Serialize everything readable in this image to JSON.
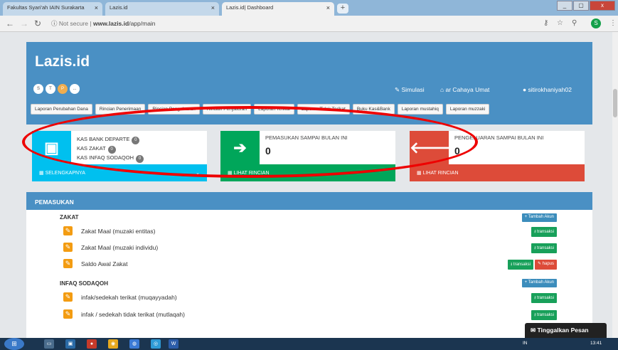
{
  "browser": {
    "tabs": [
      {
        "title": "Fakultas Syari'ah IAIN Surakarta",
        "state": "inactive"
      },
      {
        "title": "Lazis.id",
        "state": "inactive"
      },
      {
        "title": "Lazis.id| Dashboard",
        "state": "active"
      }
    ],
    "close_symbol": "×",
    "new_tab_symbol": "+",
    "url_prefix": "Not secure",
    "url_separator": "|",
    "url_host": "www.lazis.id",
    "url_path": "/app/main",
    "profile_initial": "S",
    "window_buttons": [
      "_",
      "▢",
      "x"
    ]
  },
  "app": {
    "logo": "Lazis.id",
    "avatars": [
      "S",
      "T",
      "P",
      "..."
    ],
    "top_nav": {
      "simulasi": "Simulasi",
      "org": "ar Cahaya Umat",
      "user": "sitirokhaniyah02"
    },
    "reports": [
      "Laporan Perubahan Dana",
      "Rincian Penerimaan",
      "Rincian Pengeluaran",
      "Rincian Penyaluran",
      "Laporan Terikat",
      "Laporan Tidak Terikat",
      "Buku Kas&Bank",
      "Laporan mustahiq",
      "Laporan muzzaki"
    ],
    "cards": {
      "kas": {
        "lines": [
          "KAS BANK DEPARTE",
          "KAS ZAKAT",
          "KAS INFAQ SODAQOH"
        ],
        "badges": [
          "0",
          "0",
          "0"
        ],
        "footer": "SELENGKAPNYA",
        "color": "#00c0ef"
      },
      "pemasukan": {
        "title": "PEMASUKAN SAMPAI BULAN INI",
        "value": "0",
        "footer": "LIHAT RINCIAN",
        "color": "#00a65a"
      },
      "pengeluaran": {
        "title": "PENGELUARAN SAMPAI BULAN INI",
        "value": "0",
        "footer": "LIHAT RINCIAN",
        "color": "#dd4b39"
      }
    },
    "panel": {
      "title": "PEMASUKAN",
      "sections": [
        {
          "name": "ZAKAT",
          "add_label": "Tambah Akun",
          "rows": [
            {
              "label": "Zakat Maal (muzaki entitas)",
              "buttons": [
                "transaksi"
              ]
            },
            {
              "label": "Zakat Maal (muzaki individu)",
              "buttons": [
                "transaksi"
              ]
            },
            {
              "label": "Saldo Awal Zakat",
              "buttons": [
                "transaksi",
                "hapus"
              ]
            }
          ]
        },
        {
          "name": "INFAQ SODAQOH",
          "add_label": "Tambah Akun",
          "rows": [
            {
              "label": "infak/sedekah terikat (muqayyadah)",
              "buttons": [
                "transaksi"
              ]
            },
            {
              "label": "infak / sedekah tidak terikat (mutlaqah)",
              "buttons": [
                "transaksi"
              ]
            }
          ]
        }
      ]
    },
    "chat_widget": "Tinggalkan Pesan"
  },
  "taskbar": {
    "tray": "IN",
    "clock": "13:41"
  },
  "annotation": {
    "color": "#e00000"
  }
}
